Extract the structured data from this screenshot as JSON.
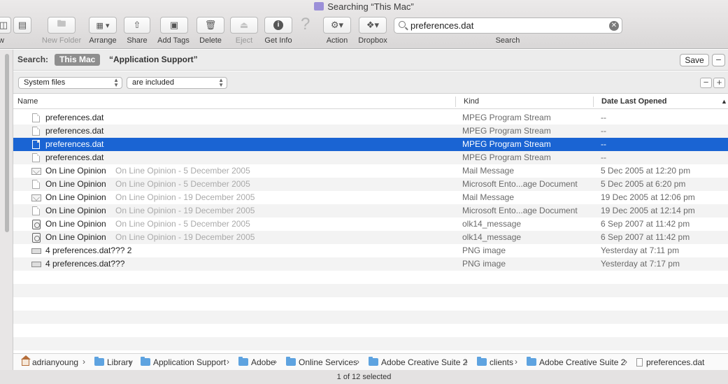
{
  "window": {
    "title": "Searching “This Mac”"
  },
  "toolbar": {
    "view_left_partial": "w",
    "new_folder": "New Folder",
    "arrange": "Arrange",
    "share": "Share",
    "add_tags": "Add Tags",
    "delete": "Delete",
    "eject": "Eject",
    "get_info": "Get Info",
    "action": "Action",
    "dropbox": "Dropbox",
    "search_label": "Search",
    "search_value": "preferences.dat"
  },
  "scope": {
    "label": "Search:",
    "this_mac": "This Mac",
    "app_support": "“Application Support”",
    "save": "Save"
  },
  "criteria": {
    "attribute": "System files",
    "operator": "are included"
  },
  "columns": {
    "name": "Name",
    "kind": "Kind",
    "date": "Date Last Opened"
  },
  "rows": [
    {
      "icon": "doc",
      "name": "preferences.dat",
      "sub": "",
      "kind": "MPEG Program Stream",
      "date": "--"
    },
    {
      "icon": "doc",
      "name": "preferences.dat",
      "sub": "",
      "kind": "MPEG Program Stream",
      "date": "--"
    },
    {
      "icon": "doc",
      "name": "preferences.dat",
      "sub": "",
      "kind": "MPEG Program Stream",
      "date": "--",
      "selected": true
    },
    {
      "icon": "doc",
      "name": "preferences.dat",
      "sub": "",
      "kind": "MPEG Program Stream",
      "date": "--"
    },
    {
      "icon": "mail",
      "name": "On Line Opinion",
      "sub": "On Line Opinion - 5 December 2005",
      "kind": "Mail Message",
      "date": "5 Dec 2005 at 12:20 pm"
    },
    {
      "icon": "doc",
      "name": "On Line Opinion",
      "sub": "On Line Opinion - 5 December 2005",
      "kind": "Microsoft Ento...age Document",
      "date": "5 Dec 2005 at 6:20 pm"
    },
    {
      "icon": "mail",
      "name": "On Line Opinion",
      "sub": "On Line Opinion - 19 December 2005",
      "kind": "Mail Message",
      "date": "19 Dec 2005 at 12:06 pm"
    },
    {
      "icon": "doc",
      "name": "On Line Opinion",
      "sub": "On Line Opinion - 19 December 2005",
      "kind": "Microsoft Ento...age Document",
      "date": "19 Dec 2005 at 12:14 pm"
    },
    {
      "icon": "olk",
      "name": "On Line Opinion",
      "sub": "On Line Opinion - 5 December 2005",
      "kind": "olk14_message",
      "date": "6 Sep 2007 at 11:42 pm"
    },
    {
      "icon": "olk",
      "name": "On Line Opinion",
      "sub": "On Line Opinion - 19 December 2005",
      "kind": "olk14_message",
      "date": "6 Sep 2007 at 11:42 pm"
    },
    {
      "icon": "png",
      "name": "4 preferences.dat??? 2",
      "sub": "",
      "kind": "PNG image",
      "date": "Yesterday at 7:11 pm"
    },
    {
      "icon": "png",
      "name": "4 preferences.dat???",
      "sub": "",
      "kind": "PNG image",
      "date": "Yesterday at 7:17 pm"
    }
  ],
  "path": [
    {
      "icon": "home",
      "label": "adrianyoung"
    },
    {
      "icon": "folder",
      "label": "Library"
    },
    {
      "icon": "folder",
      "label": "Application Support"
    },
    {
      "icon": "folder",
      "label": "Adobe"
    },
    {
      "icon": "folder",
      "label": "Online Services"
    },
    {
      "icon": "folder",
      "label": "Adobe Creative Suite 2"
    },
    {
      "icon": "folder",
      "label": "clients"
    },
    {
      "icon": "folder",
      "label": "Adobe Creative Suite 2"
    },
    {
      "icon": "file",
      "label": "preferences.dat"
    }
  ],
  "status": "1 of 12 selected",
  "colors": {
    "selection": "#1a64d3",
    "folder": "#5ea3e0"
  }
}
